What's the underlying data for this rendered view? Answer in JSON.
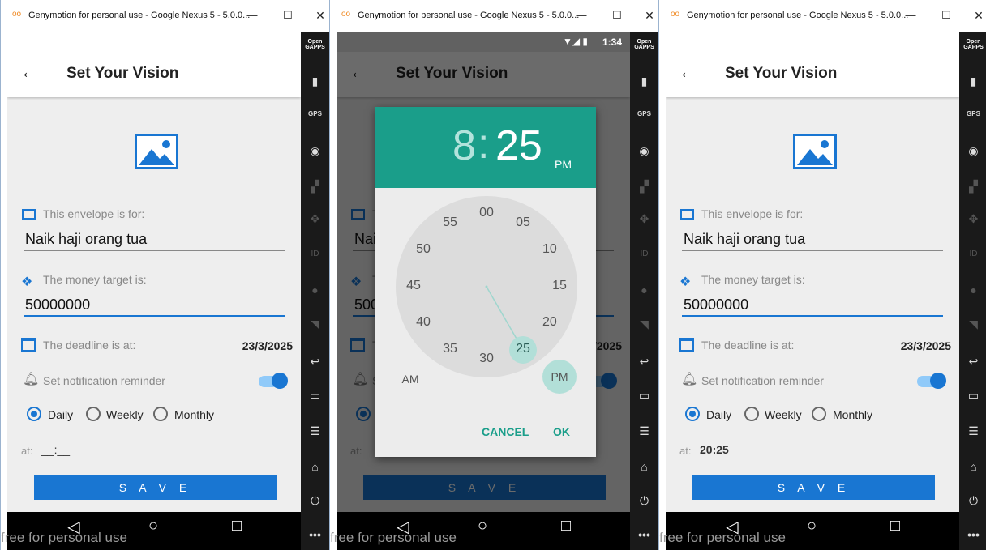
{
  "window": {
    "logo": "oo",
    "title": "Genymotion for personal use - Google Nexus 5 - 5.0.0...",
    "min": "—",
    "max": "☐",
    "close": "✕"
  },
  "sidebar": {
    "open_gapps": "Open GAPPS",
    "gps": "GPS"
  },
  "watermark": "free for personal use",
  "app": {
    "title": "Set Your Vision",
    "envelope_label": "This envelope is for:",
    "envelope_value": "Naik haji orang tua",
    "money_label": "The money target is:",
    "money_value": "50000000",
    "deadline_label": "The deadline is at:",
    "deadline_value": "23/3/2025",
    "reminder_label": "Set notification reminder",
    "options": [
      "Daily",
      "Weekly",
      "Monthly"
    ],
    "selected_option": "Daily",
    "at_label": "at:",
    "save": "S A V E"
  },
  "screens": {
    "before": {
      "at_value": "__:__"
    },
    "after": {
      "at_value": "20:25"
    }
  },
  "status_bar": {
    "time": "1:34",
    "icons": "▼◢ ▮"
  },
  "time_picker": {
    "hour": "8",
    "colon": ":",
    "minute": "25",
    "ampm": "PM",
    "selected_minute": "25",
    "dial_numbers": [
      "00",
      "05",
      "10",
      "15",
      "20",
      "25",
      "30",
      "35",
      "40",
      "45",
      "50",
      "55"
    ],
    "am": "AM",
    "pm": "PM",
    "cancel": "CANCEL",
    "ok": "OK"
  },
  "colors": {
    "primary": "#1976d2",
    "dialog_header": "#1a9e8a",
    "dial_face": "#dcdcdc",
    "selection": "#b2dfd8"
  }
}
